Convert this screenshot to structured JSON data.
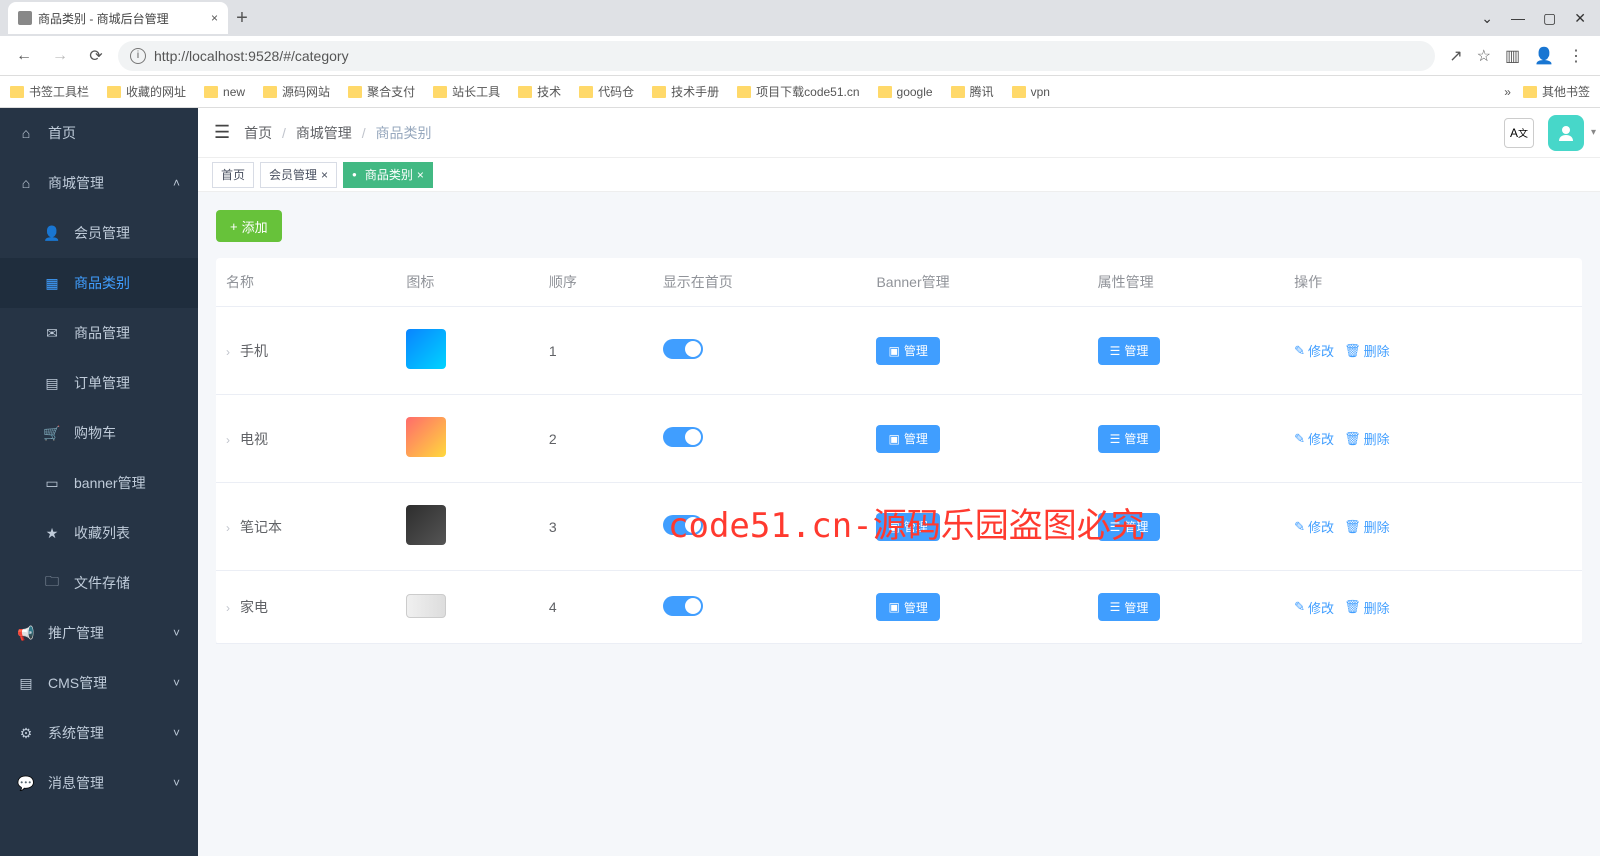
{
  "browser": {
    "tab_title": "商品类别 - 商城后台管理",
    "url": "http://localhost:9528/#/category",
    "bookmarks": [
      "书签工具栏",
      "收藏的网址",
      "new",
      "源码网站",
      "聚合支付",
      "站长工具",
      "技术",
      "代码仓",
      "技术手册",
      "项目下载code51.cn",
      "google",
      "腾讯",
      "vpn"
    ],
    "other_bookmarks": "其他书签"
  },
  "sidebar": {
    "items": [
      {
        "label": "首页",
        "icon": "⌂"
      },
      {
        "label": "商城管理",
        "icon": "⌂",
        "expanded": true,
        "children": [
          {
            "label": "会员管理",
            "icon": "👤"
          },
          {
            "label": "商品类别",
            "icon": "▦",
            "active": true
          },
          {
            "label": "商品管理",
            "icon": "✉"
          },
          {
            "label": "订单管理",
            "icon": "▤"
          },
          {
            "label": "购物车",
            "icon": "🛒"
          },
          {
            "label": "banner管理",
            "icon": "▭"
          },
          {
            "label": "收藏列表",
            "icon": "★"
          },
          {
            "label": "文件存储",
            "icon": "🗀"
          }
        ]
      },
      {
        "label": "推广管理",
        "icon": "📢"
      },
      {
        "label": "CMS管理",
        "icon": "▤"
      },
      {
        "label": "系统管理",
        "icon": "⚙"
      },
      {
        "label": "消息管理",
        "icon": "💬"
      }
    ]
  },
  "breadcrumb": {
    "home": "首页",
    "level1": "商城管理",
    "level2": "商品类别"
  },
  "tags": [
    {
      "label": "首页",
      "closable": false
    },
    {
      "label": "会员管理",
      "closable": true
    },
    {
      "label": "商品类别",
      "closable": true,
      "active": true
    }
  ],
  "toolbar": {
    "add_label": "添加"
  },
  "table": {
    "headers": {
      "name": "名称",
      "icon": "图标",
      "order": "顺序",
      "show_home": "显示在首页",
      "banner_mgmt": "Banner管理",
      "attr_mgmt": "属性管理",
      "action": "操作"
    },
    "manage_label": "管理",
    "edit_label": "修改",
    "delete_label": "删除",
    "rows": [
      {
        "name": "手机",
        "order": "1",
        "thumb_class": "phone",
        "show": true
      },
      {
        "name": "电视",
        "order": "2",
        "thumb_class": "tv",
        "show": true
      },
      {
        "name": "笔记本",
        "order": "3",
        "thumb_class": "laptop",
        "show": true
      },
      {
        "name": "家电",
        "order": "4",
        "thumb_class": "appliance",
        "show": true
      }
    ]
  },
  "watermark": "code51.cn-源码乐园盗图必究"
}
